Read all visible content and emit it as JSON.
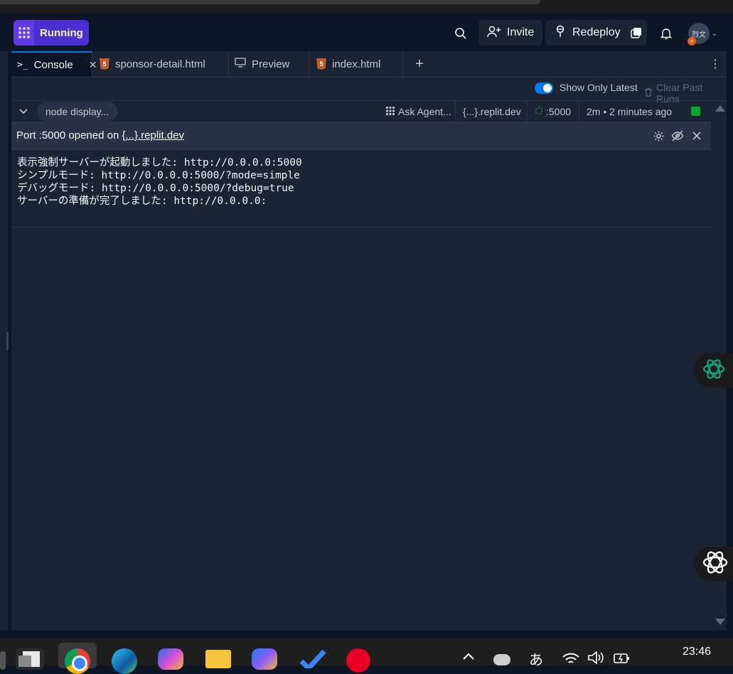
{
  "header": {
    "run_label": "Running",
    "invite_label": "Invite",
    "redeploy_label": "Redeploy",
    "avatar_text": "烈文"
  },
  "tabs": [
    {
      "label": "Console",
      "icon": "terminal-icon"
    },
    {
      "label": "sponsor-detail.html",
      "icon": "html5-icon"
    },
    {
      "label": "Preview",
      "icon": "monitor-icon"
    },
    {
      "label": "index.html",
      "icon": "html5-icon"
    }
  ],
  "options": {
    "show_only_latest": "Show Only Latest",
    "show_only_latest_enabled": true,
    "clear_past_runs": "Clear Past Runs"
  },
  "run": {
    "command": "node display...",
    "ask_agent": "Ask Agent...",
    "domain": "{...}.replit.dev",
    "port": ":5000",
    "time": "2m • 2 minutes ago",
    "status_color": "#00a82d"
  },
  "notice": {
    "prefix": "Port :5000 opened on ",
    "link": "{...}.replit.dev"
  },
  "output": [
    "表示強制サーバーが起動しました: http://0.0.0.0:5000",
    "シンプルモード: http://0.0.0.0:5000/?mode=simple",
    "デバッグモード: http://0.0.0.0:5000/?debug=true",
    "サーバーの準備が完了しました: http://0.0.0.0:"
  ],
  "taskbar": {
    "clock": "23:46",
    "ime": "あ"
  },
  "colors": {
    "accent": "#0079f2",
    "running_bg": "#4c2fd1",
    "background": "#0e1525",
    "surface": "#1c2333"
  }
}
